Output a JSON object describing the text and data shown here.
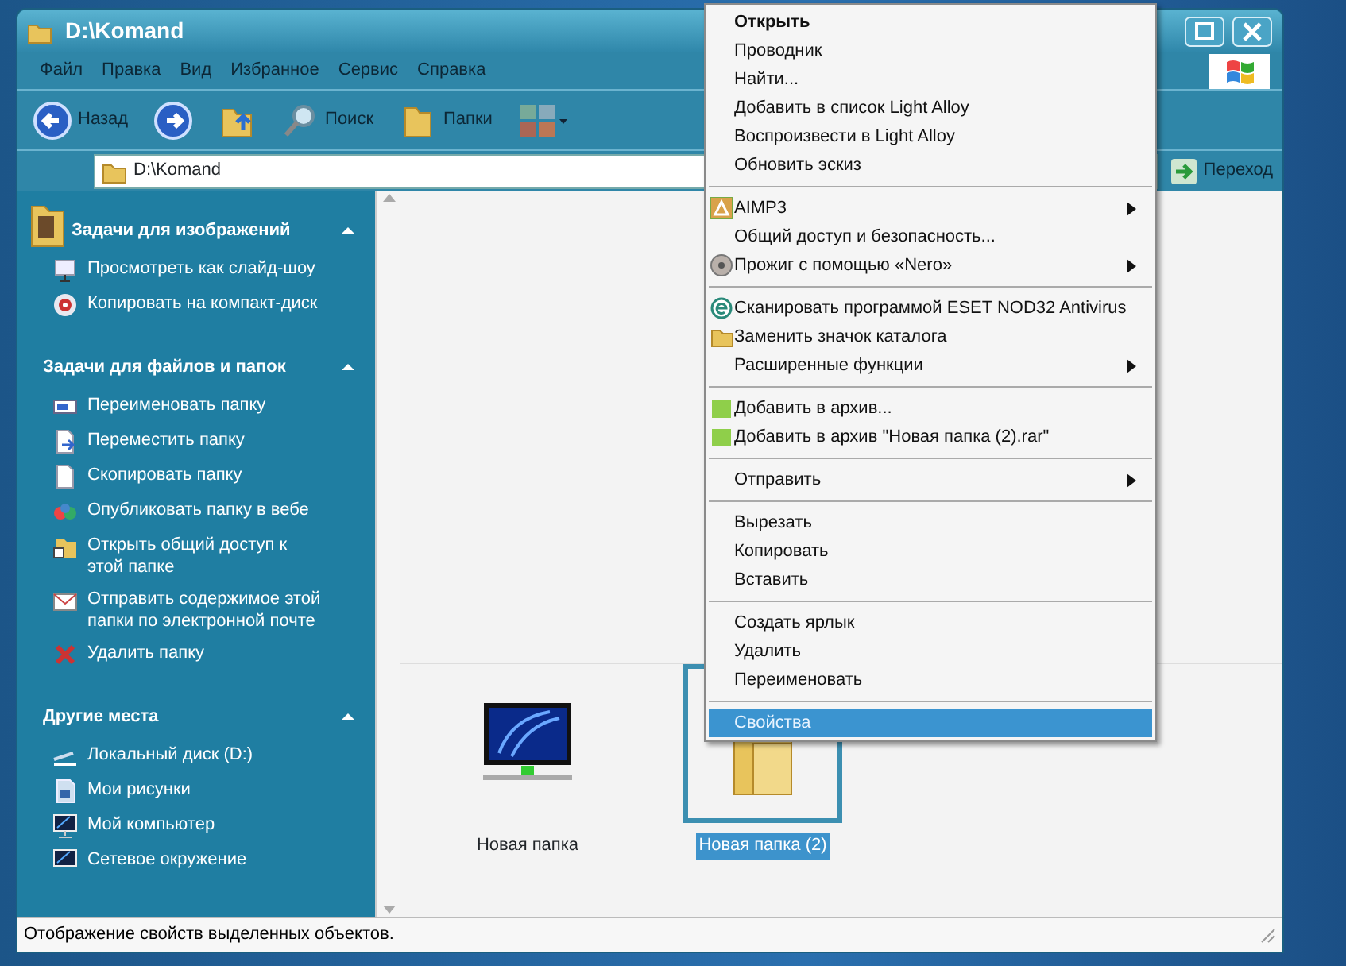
{
  "window": {
    "title": "D:\\Komand"
  },
  "menu_bar": [
    "Файл",
    "Правка",
    "Вид",
    "Избранное",
    "Сервис",
    "Справка"
  ],
  "toolbar": [
    {
      "kind": "back",
      "label": "Назад"
    },
    {
      "kind": "forward"
    },
    {
      "kind": "up"
    },
    {
      "kind": "search",
      "label": "Поиск"
    },
    {
      "kind": "folders",
      "label": "Папки"
    },
    {
      "kind": "views"
    }
  ],
  "address_bar": {
    "value": "D:\\Komand",
    "go_label": "Переход"
  },
  "task_panel": [
    {
      "title": "Задачи для изображений",
      "expanded": true,
      "items": [
        {
          "kind": "slideshow",
          "label": "Просмотреть как слайд-шоу"
        },
        {
          "kind": "cd",
          "label": "Копировать на компакт-диск"
        }
      ]
    },
    {
      "title": "Задачи для файлов и папок",
      "expanded": true,
      "items": [
        {
          "kind": "rename",
          "label": "Переименовать папку"
        },
        {
          "kind": "move",
          "label": "Переместить папку"
        },
        {
          "kind": "copy",
          "label": "Скопировать папку"
        },
        {
          "kind": "publish",
          "label": "Опубликовать папку в вебе"
        },
        {
          "kind": "share",
          "label": "Открыть общий доступ к этой папке"
        },
        {
          "kind": "email",
          "label": "Отправить содержимое этой папки по электронной почте"
        },
        {
          "kind": "delete",
          "label": "Удалить папку"
        }
      ]
    },
    {
      "title": "Другие места",
      "expanded": true,
      "items": [
        {
          "kind": "disk",
          "label": "Локальный диск (D:)"
        },
        {
          "kind": "pictures",
          "label": "Мои рисунки"
        },
        {
          "kind": "computer",
          "label": "Мой компьютер"
        },
        {
          "kind": "network",
          "label": "Сетевое окружение"
        }
      ]
    }
  ],
  "files": [
    {
      "kind": "monitor",
      "name": "Новая папка",
      "selected": false
    },
    {
      "kind": "folder",
      "name": "Новая папка (2)",
      "selected": true
    }
  ],
  "context_menu": [
    {
      "kind": "entry",
      "label": "Открыть",
      "default": true,
      "submenu": false,
      "selected": false
    },
    {
      "kind": "entry",
      "label": "Проводник",
      "default": false,
      "submenu": false,
      "selected": false
    },
    {
      "kind": "entry",
      "label": "Найти...",
      "default": false,
      "submenu": false,
      "selected": false
    },
    {
      "kind": "entry",
      "label": "Добавить в список Light Alloy",
      "default": false,
      "submenu": false,
      "selected": false
    },
    {
      "kind": "entry",
      "label": "Воспроизвести в Light Alloy",
      "default": false,
      "submenu": false,
      "selected": false
    },
    {
      "kind": "entry",
      "label": "Обновить эскиз",
      "default": false,
      "submenu": false,
      "selected": false
    },
    {
      "kind": "separator"
    },
    {
      "kind": "aimp",
      "label": "AIMP3",
      "default": false,
      "submenu": true,
      "selected": false
    },
    {
      "kind": "entry",
      "label": "Общий доступ и безопасность...",
      "default": false,
      "submenu": false,
      "selected": false
    },
    {
      "kind": "nero",
      "label": "Прожиг с помощью «Nero»",
      "default": false,
      "submenu": true,
      "selected": false
    },
    {
      "kind": "separator"
    },
    {
      "kind": "eset",
      "label": "Сканировать программой ESET NOD32 Antivirus",
      "default": false,
      "submenu": false,
      "selected": false
    },
    {
      "kind": "folder",
      "label": "Заменить значок каталога",
      "default": false,
      "submenu": false,
      "selected": false
    },
    {
      "kind": "entry",
      "label": "Расширенные функции",
      "default": false,
      "submenu": true,
      "selected": false
    },
    {
      "kind": "separator"
    },
    {
      "kind": "archive",
      "label": "Добавить в архив...",
      "default": false,
      "submenu": false,
      "selected": false
    },
    {
      "kind": "archive",
      "label": "Добавить в архив \"Новая папка (2).rar\"",
      "default": false,
      "submenu": false,
      "selected": false
    },
    {
      "kind": "separator"
    },
    {
      "kind": "entry",
      "label": "Отправить",
      "default": false,
      "submenu": true,
      "selected": false
    },
    {
      "kind": "separator"
    },
    {
      "kind": "entry",
      "label": "Вырезать",
      "default": false,
      "submenu": false,
      "selected": false
    },
    {
      "kind": "entry",
      "label": "Копировать",
      "default": false,
      "submenu": false,
      "selected": false
    },
    {
      "kind": "entry",
      "label": "Вставить",
      "default": false,
      "submenu": false,
      "selected": false
    },
    {
      "kind": "separator"
    },
    {
      "kind": "entry",
      "label": "Создать ярлык",
      "default": false,
      "submenu": false,
      "selected": false
    },
    {
      "kind": "entry",
      "label": "Удалить",
      "default": false,
      "submenu": false,
      "selected": false
    },
    {
      "kind": "entry",
      "label": "Переименовать",
      "default": false,
      "submenu": false,
      "selected": false
    },
    {
      "kind": "separator"
    },
    {
      "kind": "entry",
      "label": "Свойства",
      "default": false,
      "submenu": false,
      "selected": true
    }
  ],
  "status_bar": "Отображение свойств выделенных объектов."
}
